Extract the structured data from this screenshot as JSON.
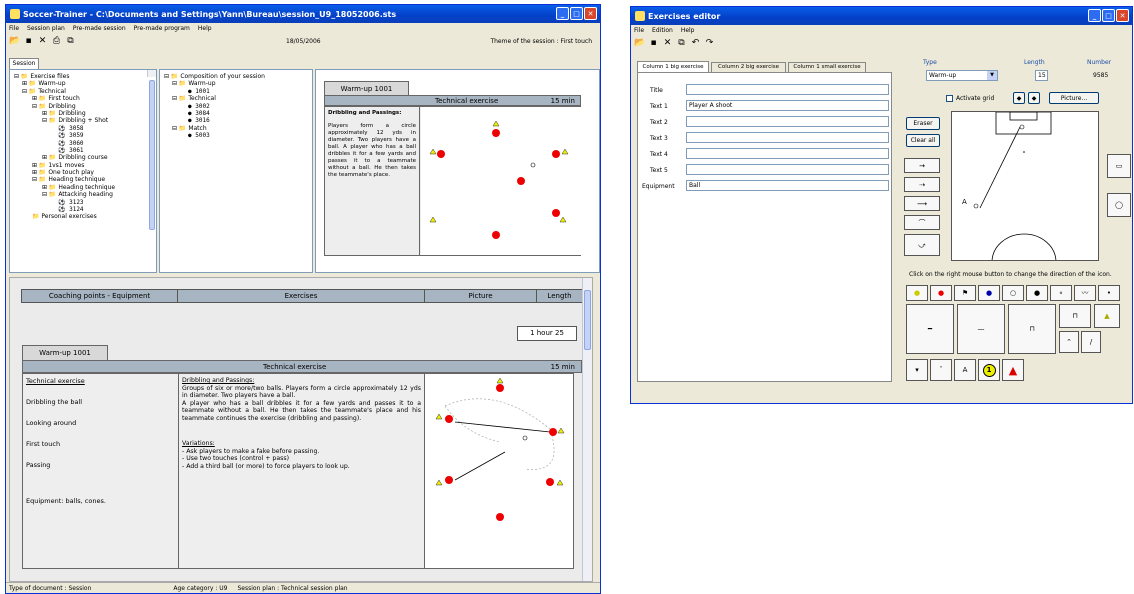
{
  "main": {
    "title": "Soccer-Trainer - C:\\Documents and Settings\\Yann\\Bureau\\session_U9_18052006.sts",
    "menu": [
      "File",
      "Session plan",
      "Pre-made session",
      "Pre-made program",
      "Help"
    ],
    "date": "18/05/2006",
    "theme": "Theme of the session : First touch",
    "tab": "Session",
    "tree": [
      "Exercise files",
      "Warm-up",
      "Technical",
      "First touch",
      "Dribbling",
      "Dribbling",
      "Dribbling + Shot",
      "3058",
      "3059",
      "3060",
      "3061",
      "Dribbling course",
      "1vs1 moves",
      "One touch play",
      "Heading technique",
      "Heading technique",
      "Attacking heading",
      "3123",
      "3124",
      "Personal exercises"
    ],
    "composition": [
      "Composition of your session",
      "Warm-up",
      "1001",
      "Technical",
      "3002",
      "3084",
      "3016",
      "Match",
      "5003"
    ],
    "preview": {
      "tab": "Warm-up 1001",
      "bar": "Technical exercise",
      "time": "15 min",
      "heading": "Dribbling and Passings:",
      "text": "Players form a circle approximately 12 yds in diameter. Two players have a ball. A player who has a ball dribbles it for a few yards and passes it to a teammate without a ball. He then takes the teammate's place."
    },
    "grid_headers": [
      "Coaching points - Equipment",
      "Exercises",
      "Picture",
      "Length"
    ],
    "total": "1 hour 25",
    "ex": {
      "tab": "Warm-up 1001",
      "bar": "Technical exercise",
      "time": "15 min",
      "left": [
        "Technical exercise",
        "Dribbling the ball",
        "Looking around",
        "First touch",
        "Passing",
        "Equipment: balls, cones."
      ],
      "heading": "Dribbling and Passings:",
      "text1": "Groups of six or more/two balls. Players form a circle approximately 12 yds in diameter. Two players have a ball.",
      "text2": "A player who has a ball dribbles it for a few yards and passes it to a teammate without a ball. He then takes the teammate's place and his teammate continues the exercise (dribbling and passing).",
      "var_head": "Variations:",
      "vars": [
        "- Ask players to make a fake before passing.",
        "- Use two touches (control + pass)",
        "- Add a third ball (or more) to force players to look up."
      ]
    },
    "status": [
      "Type of document : Session",
      "Age category : U9",
      "Session plan : Technical session plan"
    ]
  },
  "editor": {
    "title": "Exercises editor",
    "menu": [
      "File",
      "Edition",
      "Help"
    ],
    "tabs": [
      "Column 1 big exercise",
      "Column 2 big exercise",
      "Column 1 small exercise"
    ],
    "type_label": "Type",
    "type_value": "Warm-up",
    "length_label": "Length",
    "length_value": "15",
    "number_label": "Number",
    "number_value": "9585",
    "fields": [
      {
        "label": "Title",
        "value": ""
      },
      {
        "label": "Text 1",
        "value": "Player A shoot"
      },
      {
        "label": "Text 2",
        "value": ""
      },
      {
        "label": "Text 3",
        "value": ""
      },
      {
        "label": "Text 4",
        "value": ""
      },
      {
        "label": "Text 5",
        "value": ""
      },
      {
        "label": "Equipment",
        "value": "Ball"
      }
    ],
    "activate_grid": "Activate grid",
    "picture_btn": "Picture...",
    "eraser": "Eraser",
    "clear_all": "Clear all",
    "hint": "Click on the right mouse button to change the direction of the icon.",
    "letter_a": "A"
  }
}
